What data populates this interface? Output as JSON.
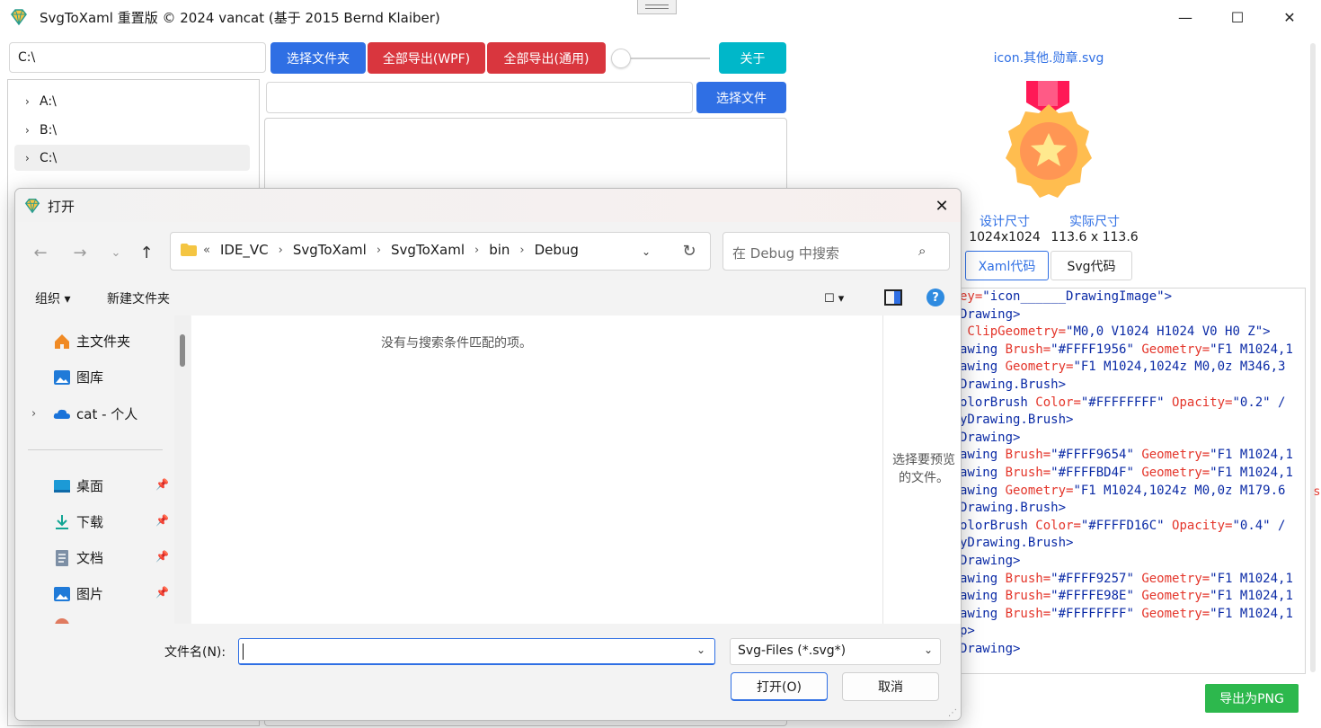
{
  "app": {
    "title": "SvgToXaml 重置版   © 2024 vancat (基于 2015 Bernd Klaiber)",
    "path_value": "C:\\",
    "buttons": {
      "select_folder": "选择文件夹",
      "export_wpf": "全部导出(WPF)",
      "export_general": "全部导出(通用)",
      "about": "关于",
      "select_file": "选择文件",
      "export_png": "导出为PNG"
    },
    "tree": [
      {
        "label": "A:\\",
        "chevron": "›"
      },
      {
        "label": "B:\\",
        "chevron": "›"
      },
      {
        "label": "C:\\",
        "chevron": "›"
      }
    ],
    "window_controls": {
      "minimize": "—",
      "maximize": "☐",
      "close": "✕"
    }
  },
  "preview": {
    "filename": "icon.其他.勋章.svg",
    "design_size_label": "设计尺寸",
    "design_size_value": "1024x1024",
    "real_size_label": "实际尺寸",
    "real_size_value": "113.6 x 113.6",
    "tab_xaml": "Xaml代码",
    "tab_svg": "Svg代码",
    "code_lines": [
      [
        "a",
        "ey=",
        "v",
        "\"icon______DrawingImage\"",
        "b",
        ">"
      ],
      [
        "b",
        "Drawing>"
      ],
      [
        "a",
        " ClipGeometry=",
        "v",
        "\"M0,0 V1024 H1024 V0 H0 Z\"",
        "b",
        ">"
      ],
      [
        "b",
        "awing ",
        "a",
        "Brush=",
        "v",
        "\"#FFFF1956\" ",
        "a",
        "Geometry=",
        "v",
        "\"F1 M1024,1"
      ],
      [
        "b",
        "awing ",
        "a",
        "Geometry=",
        "v",
        "\"F1 M1024,1024z M0,0z M346,3"
      ],
      [
        "b",
        "Drawing.Brush>"
      ],
      [
        "b",
        "olorBrush ",
        "a",
        "Color=",
        "v",
        "\"#FFFFFFFF\" ",
        "a",
        "Opacity=",
        "v",
        "\"0.2\" ",
        "b",
        "/"
      ],
      [
        "b",
        "yDrawing.Brush>"
      ],
      [
        "b",
        "Drawing>"
      ],
      [
        "b",
        "awing ",
        "a",
        "Brush=",
        "v",
        "\"#FFFF9654\" ",
        "a",
        "Geometry=",
        "v",
        "\"F1 M1024,1"
      ],
      [
        "b",
        "awing ",
        "a",
        "Brush=",
        "v",
        "\"#FFFFBD4F\" ",
        "a",
        "Geometry=",
        "v",
        "\"F1 M1024,1"
      ],
      [
        "b",
        "awing ",
        "a",
        "Geometry=",
        "v",
        "\"F1 M1024,1024z M0,0z M179.6"
      ],
      [
        "b",
        "Drawing.Brush>"
      ],
      [
        "b",
        "olorBrush ",
        "a",
        "Color=",
        "v",
        "\"#FFFFD16C\" ",
        "a",
        "Opacity=",
        "v",
        "\"0.4\" ",
        "b",
        "/"
      ],
      [
        "b",
        "yDrawing.Brush>"
      ],
      [
        "b",
        "Drawing>"
      ],
      [
        "b",
        "awing ",
        "a",
        "Brush=",
        "v",
        "\"#FFFF9257\" ",
        "a",
        "Geometry=",
        "v",
        "\"F1 M1024,1"
      ],
      [
        "b",
        "awing ",
        "a",
        "Brush=",
        "v",
        "\"#FFFFE98E\" ",
        "a",
        "Geometry=",
        "v",
        "\"F1 M1024,1"
      ],
      [
        "b",
        "awing ",
        "a",
        "Brush=",
        "v",
        "\"#FFFFFFFF\" ",
        "a",
        "Geometry=",
        "v",
        "\"F1 M1024,1"
      ],
      [
        "b",
        "p>"
      ],
      [
        "b",
        "Drawing>"
      ]
    ],
    "side_mark": "s"
  },
  "dialog": {
    "title": "打开",
    "close": "✕",
    "nav": {
      "back": "←",
      "forward": "→",
      "history": "⌄",
      "up": "↑"
    },
    "address": {
      "prefix": "«",
      "crumbs": [
        "IDE_VC",
        "SvgToXaml",
        "SvgToXaml",
        "bin",
        "Debug"
      ],
      "sep": "›",
      "dropdown": "⌄",
      "refresh": "↻"
    },
    "search_placeholder": "在 Debug 中搜索",
    "search_icon": "⌕",
    "organize": "组织 ▾",
    "new_folder": "新建文件夹",
    "view_icon": "☐ ▾",
    "help_icon": "?",
    "nav_items": {
      "home": "主文件夹",
      "gallery": "图库",
      "cloud": "cat - 个人",
      "desktop": "桌面",
      "downloads": "下载",
      "documents": "文档",
      "pictures": "图片"
    },
    "pin": "📌",
    "empty_text": "没有与搜索条件匹配的项。",
    "preview_text_1": "选择要预览",
    "preview_text_2": "的文件。",
    "filename_label": "文件名(N):",
    "filename_value": "",
    "filetype": "Svg-Files (*.svg*)",
    "open_button": "打开(O)",
    "cancel_button": "取消",
    "colors": {
      "accent": "#2f6fe4",
      "danger": "#d9363e",
      "teal": "#00b7c9",
      "success": "#2db84d"
    }
  }
}
